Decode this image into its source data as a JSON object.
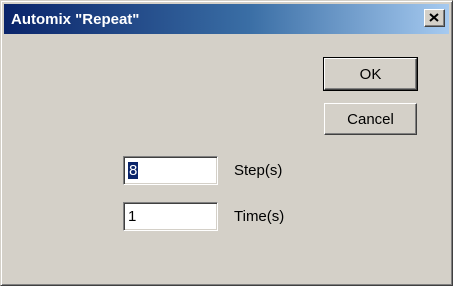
{
  "dialog": {
    "title": "Automix \"Repeat\"",
    "close_icon": "close-x-icon"
  },
  "buttons": {
    "ok_label": "OK",
    "cancel_label": "Cancel"
  },
  "fields": {
    "steps": {
      "value": "8",
      "label": "Step(s)"
    },
    "times": {
      "value": "1",
      "label": "Time(s)"
    }
  },
  "colors": {
    "face": "#d4d0c8",
    "titlebar_start": "#0a246a",
    "titlebar_end": "#a6caf0",
    "selection": "#0a246a"
  }
}
